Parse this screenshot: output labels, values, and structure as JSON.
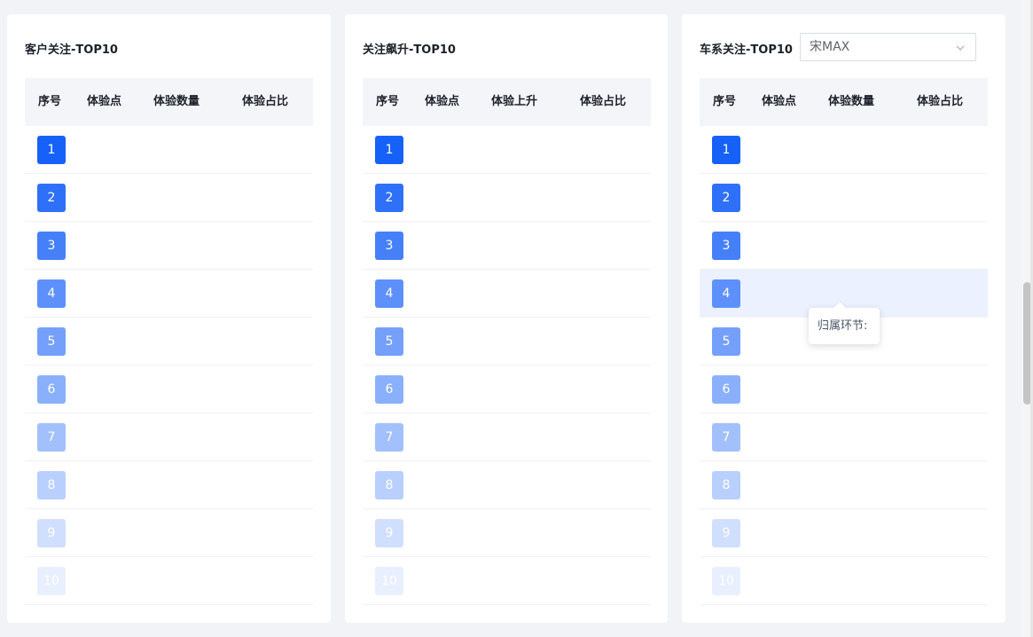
{
  "panels": [
    {
      "title": "客户关注-TOP10",
      "columns": [
        "序号",
        "体验点",
        "体验数量",
        "体验占比"
      ],
      "ranks": [
        "1",
        "2",
        "3",
        "4",
        "5",
        "6",
        "7",
        "8",
        "9",
        "10"
      ]
    },
    {
      "title": "关注飙升-TOP10",
      "columns": [
        "序号",
        "体验点",
        "体验上升",
        "体验占比"
      ],
      "ranks": [
        "1",
        "2",
        "3",
        "4",
        "5",
        "6",
        "7",
        "8",
        "9",
        "10"
      ]
    },
    {
      "title": "车系关注-TOP10",
      "columns": [
        "序号",
        "体验点",
        "体验数量",
        "体验占比"
      ],
      "ranks": [
        "1",
        "2",
        "3",
        "4",
        "5",
        "6",
        "7",
        "8",
        "9",
        "10"
      ],
      "select": {
        "value": "宋MAX"
      },
      "hover_row": 4
    }
  ],
  "tooltip": {
    "text": "归属环节:"
  },
  "rank_colors": [
    "#1661f7",
    "#2e71f8",
    "#4580f9",
    "#5d90fa",
    "#74a0fb",
    "#8bb0fb",
    "#a2c0fc",
    "#b9cffd",
    "#d1dffe",
    "#e8effe"
  ],
  "icons": {
    "select_arrow": "chevron-down-icon"
  }
}
